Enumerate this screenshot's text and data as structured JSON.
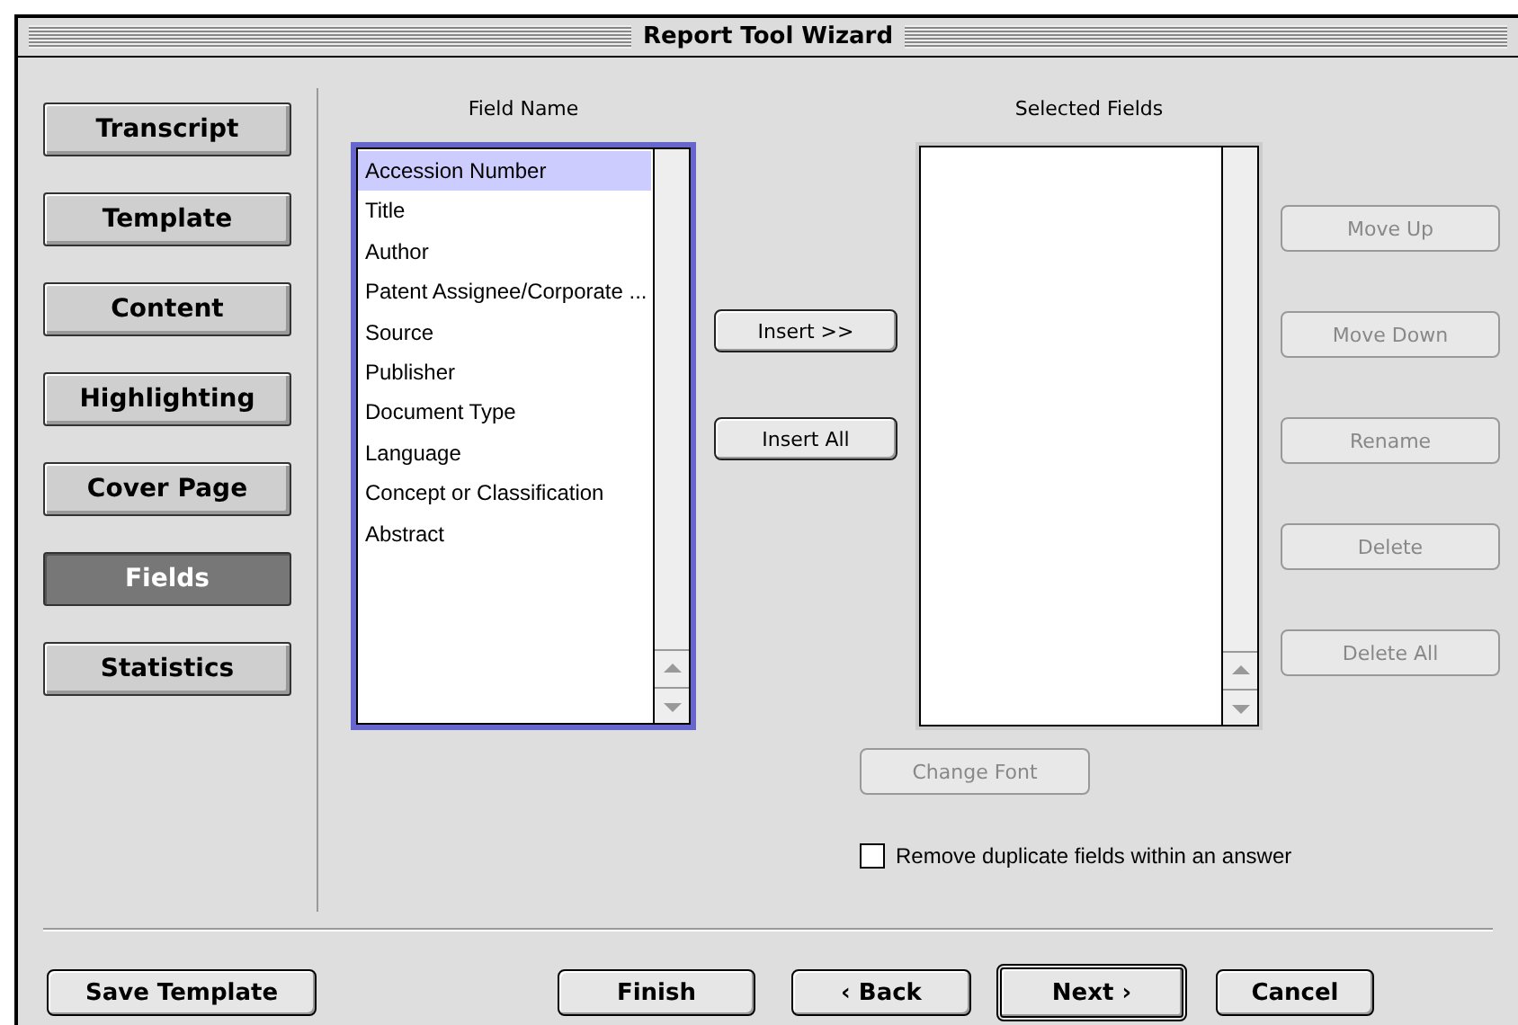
{
  "window": {
    "title": "Report Tool Wizard"
  },
  "nav": [
    {
      "label": "Transcript",
      "selected": false
    },
    {
      "label": "Template",
      "selected": false
    },
    {
      "label": "Content",
      "selected": false
    },
    {
      "label": "Highlighting",
      "selected": false
    },
    {
      "label": "Cover Page",
      "selected": false
    },
    {
      "label": "Fields",
      "selected": true
    },
    {
      "label": "Statistics",
      "selected": false
    }
  ],
  "field_list": {
    "label": "Field Name",
    "items": [
      {
        "label": "Accession Number",
        "selected": true
      },
      {
        "label": "Title",
        "selected": false
      },
      {
        "label": "Author",
        "selected": false
      },
      {
        "label": "Patent Assignee/Corporate ...",
        "selected": false
      },
      {
        "label": "Source",
        "selected": false
      },
      {
        "label": "Publisher",
        "selected": false
      },
      {
        "label": "Document Type",
        "selected": false
      },
      {
        "label": "Language",
        "selected": false
      },
      {
        "label": "Concept or Classification",
        "selected": false
      },
      {
        "label": "Abstract",
        "selected": false
      }
    ]
  },
  "insert_buttons": [
    {
      "label": "Insert >>",
      "disabled": false
    },
    {
      "label": "Insert All",
      "disabled": false
    }
  ],
  "selected_list": {
    "label": "Selected Fields"
  },
  "actions": [
    {
      "label": "Move Up",
      "disabled": true
    },
    {
      "label": "Move Down",
      "disabled": true
    },
    {
      "label": "Rename",
      "disabled": true
    },
    {
      "label": "Delete",
      "disabled": true
    },
    {
      "label": "Delete All",
      "disabled": true
    }
  ],
  "change_font": {
    "label": "Change Font",
    "disabled": true
  },
  "remove_duplicates": {
    "label": "Remove duplicate fields within an answer",
    "checked": false
  },
  "footer": [
    {
      "label": "Save Template",
      "kind": "normal"
    },
    {
      "label": "Finish",
      "kind": "normal"
    },
    {
      "label": "‹ Back",
      "kind": "normal"
    },
    {
      "label": "Next ›",
      "kind": "default"
    },
    {
      "label": "Cancel",
      "kind": "normal"
    }
  ]
}
